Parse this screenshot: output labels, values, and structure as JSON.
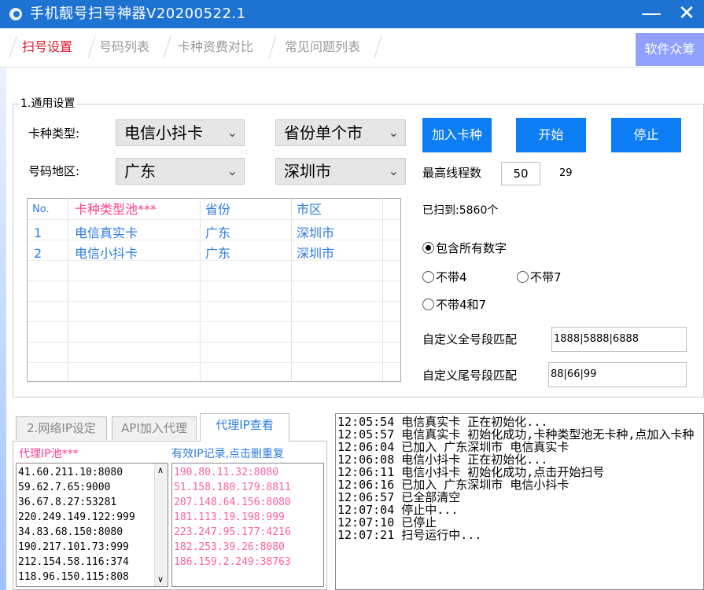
{
  "titlebar": {
    "title": "手机靓号扫号神器V20200522.1",
    "minimize": "—",
    "close": "✕"
  },
  "tabs": [
    "扫号设置",
    "号码列表",
    "卡种资费对比",
    "常见问题列表"
  ],
  "crowd_button": "软件众筹",
  "general": {
    "group_title": "1.通用设置",
    "card_type_label": "卡种类型:",
    "card_type_value": "电信小抖卡",
    "province_mode_value": "省份单个市",
    "region_label": "号码地区:",
    "region_province": "广东",
    "region_city": "深圳市",
    "btn_add": "加入卡种",
    "btn_start": "开始",
    "btn_stop": "停止",
    "max_threads_label": "最高线程数",
    "max_threads_value": "50",
    "current_threads": "29",
    "scanned": "已扫到:5860个"
  },
  "grid": {
    "headers": [
      "No.",
      "卡种类型池***",
      "省份",
      "市区"
    ],
    "rows": [
      [
        "1",
        "电信真实卡",
        "广东",
        "深圳市"
      ],
      [
        "2",
        "电信小抖卡",
        "广东",
        "深圳市"
      ]
    ]
  },
  "options": {
    "radio_all": "包含所有数字",
    "radio_no4": "不带4",
    "radio_no7": "不带7",
    "radio_no47": "不带4和7",
    "full_match_label": "自定义全号段匹配",
    "full_match_value": "1888|5888|6888",
    "tail_match_label": "自定义尾号段匹配",
    "tail_match_value": "88|66|99"
  },
  "ip_tabs": [
    "2.网络IP设定",
    "API加入代理",
    "代理IP查看"
  ],
  "ip_pool": {
    "title": "代理IP池***",
    "items": [
      "41.60.211.10:8080",
      "59.62.7.65:9000",
      "36.67.8.27:53281",
      "220.249.149.122:999",
      "34.83.68.150:8080",
      "190.217.101.73:999",
      "212.154.58.116:374",
      "118.96.150.115:808"
    ]
  },
  "valid_ip": {
    "title": "有效IP记录,点击删重复",
    "items": [
      "190.80.11.32:8080",
      "51.158.180.179:8811",
      "207.148.64.156:8080",
      "181.113.19.198:999",
      "223.247.95.177:4216",
      "182.253.39.26:8080",
      "186.159.2.249:38763"
    ]
  },
  "log": [
    "12:05:54 电信真实卡 正在初始化...",
    "12:05:57 电信真实卡 初始化成功,卡种类型池无卡种,点加入卡种",
    "12:06:04 已加入 广东深圳市 电信真实卡",
    "12:06:08 电信小抖卡 正在初始化...",
    "12:06:11 电信小抖卡 初始化成功,点击开始扫号",
    "12:06:16 已加入 广东深圳市 电信小抖卡",
    "12:06:57 已全部清空",
    "12:07:04 停止中...",
    "12:07:10 已停止",
    "12:07:21 扫号运行中..."
  ],
  "colors": {
    "titlebar": "#1e73d2",
    "button_blue": "#0c7df2",
    "tab_active": "#e0182b",
    "grid_text": "#2a7be0",
    "valid_ip_text": "#ff5fa2",
    "crowd_button": "#8fa0ff"
  }
}
